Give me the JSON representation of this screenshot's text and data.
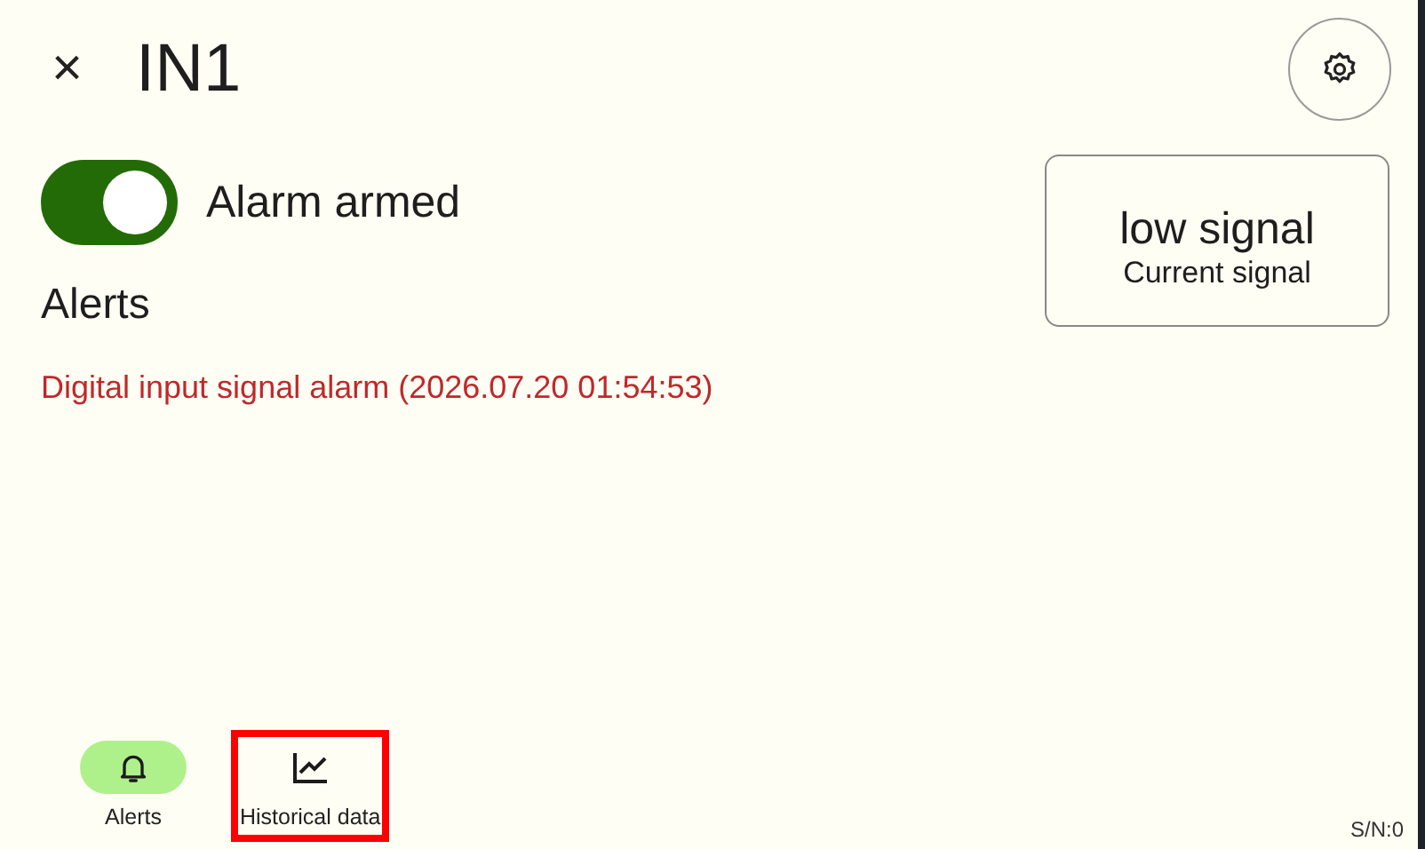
{
  "header": {
    "close": "×",
    "title": "IN1"
  },
  "alarm_toggle": {
    "label": "Alarm armed",
    "on": true
  },
  "alerts": {
    "heading": "Alerts",
    "items": [
      "Digital input signal alarm (2026.07.20 01:54:53)"
    ]
  },
  "signal_card": {
    "value": "low signal",
    "caption": "Current signal"
  },
  "nav": [
    {
      "kind": "bell",
      "label": "Alerts",
      "selected": true,
      "highlighted": false
    },
    {
      "kind": "chart",
      "label": "Historical data",
      "selected": false,
      "highlighted": true
    }
  ],
  "serial": "S/N:0"
}
